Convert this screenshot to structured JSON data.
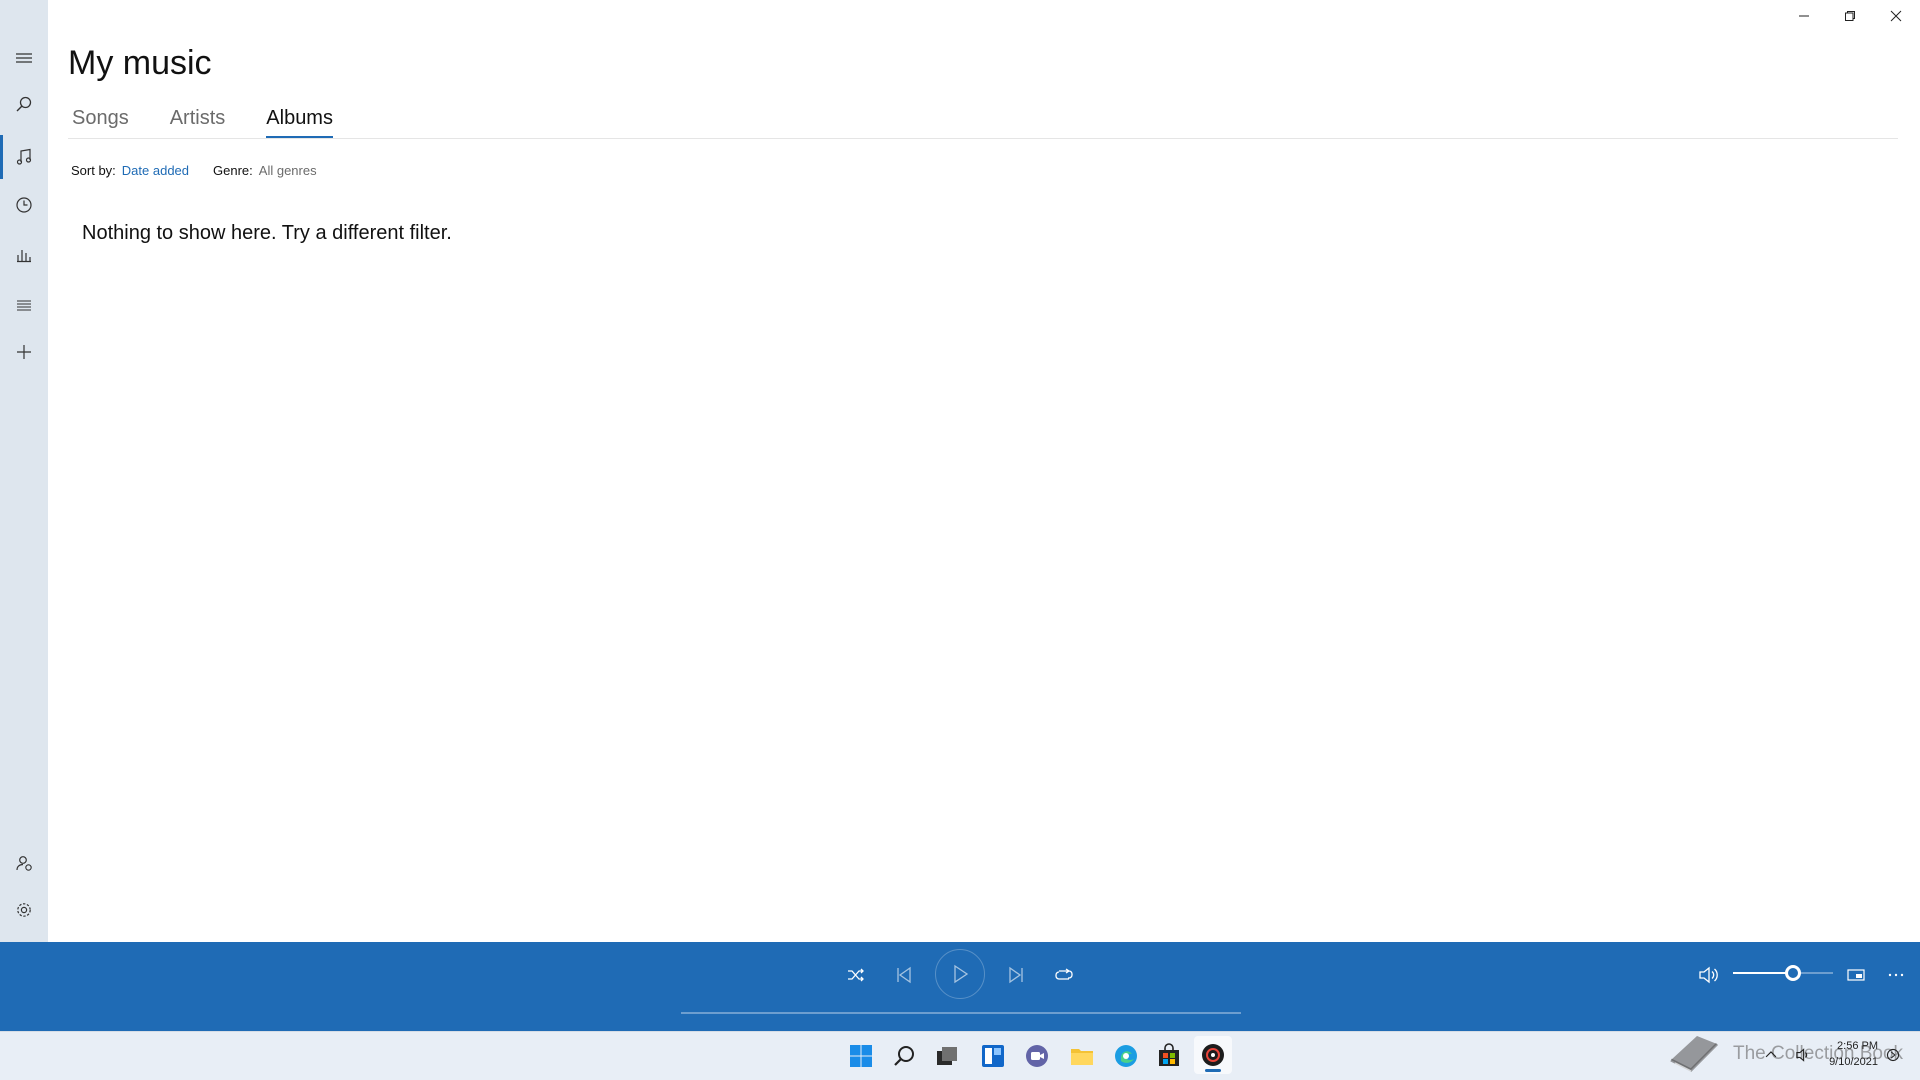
{
  "window": {
    "controls": {
      "minimize": "minimize",
      "restore": "restore",
      "close": "close"
    }
  },
  "nav_rail": {
    "items": [
      "hamburger-menu",
      "search",
      "my-music",
      "recent-plays",
      "now-playing",
      "playlists",
      "new-playlist"
    ],
    "bottom_items": [
      "sign-in",
      "settings"
    ],
    "active": "my-music"
  },
  "header": {
    "title": "My music",
    "tabs": [
      {
        "label": "Songs",
        "active": false
      },
      {
        "label": "Artists",
        "active": false
      },
      {
        "label": "Albums",
        "active": true
      }
    ]
  },
  "filters": {
    "sort_label": "Sort by:",
    "sort_value": "Date added",
    "genre_label": "Genre:",
    "genre_value": "All genres"
  },
  "content": {
    "empty_message": "Nothing to show here. Try a different filter."
  },
  "player": {
    "controls": [
      "shuffle",
      "previous",
      "play",
      "next",
      "repeat"
    ],
    "volume_level": 0.6,
    "right_controls": [
      "volume",
      "mini-view",
      "more"
    ]
  },
  "taskbar": {
    "apps": [
      "start",
      "search",
      "task-view",
      "widgets",
      "chat",
      "file-explorer",
      "edge",
      "store",
      "groove-music"
    ],
    "active_app": "groove-music",
    "time": "2:56 PM",
    "date": "9/10/2021"
  },
  "watermark": {
    "text": "The Collection Book"
  },
  "colors": {
    "accent": "#1f6bb5",
    "rail_bg": "#dee6ee",
    "taskbar_bg": "#e8eef6"
  }
}
